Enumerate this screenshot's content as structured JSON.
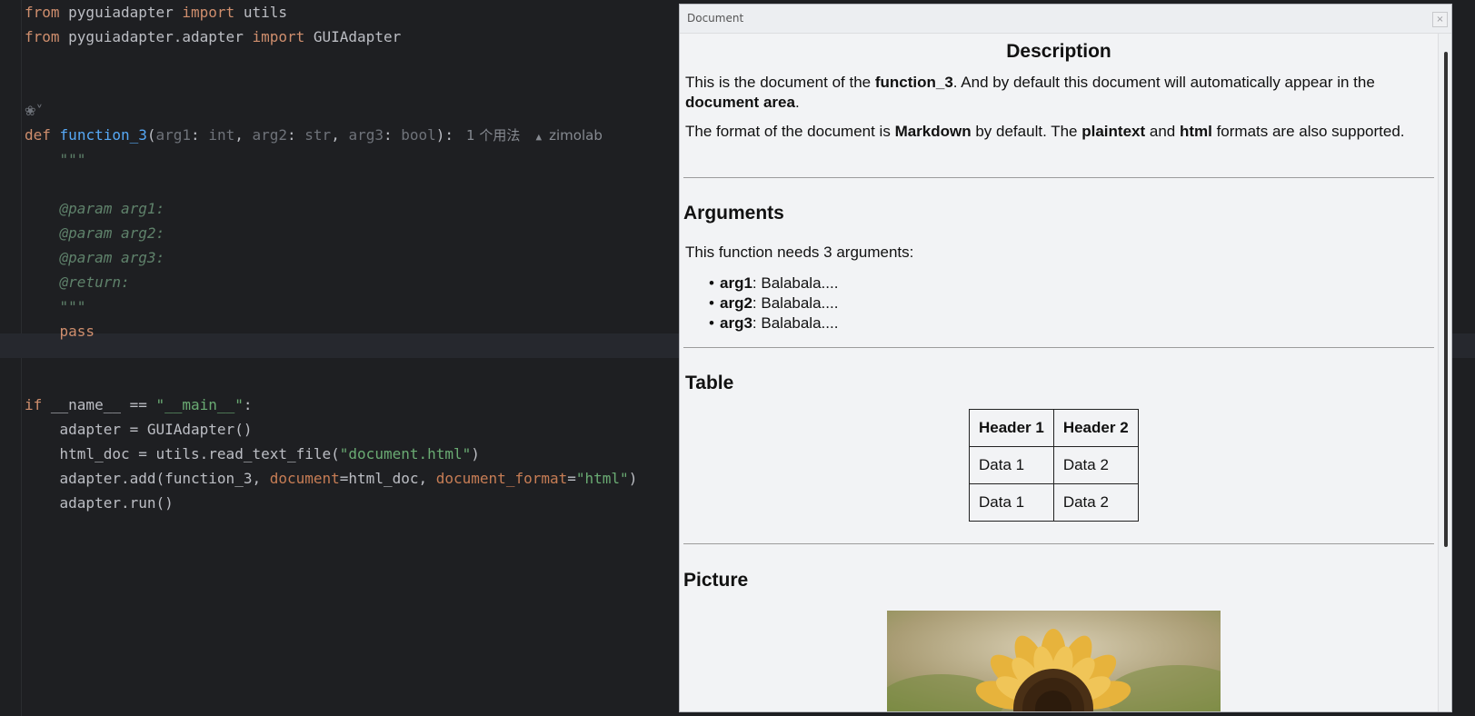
{
  "editor": {
    "lines": [
      {
        "segments": [
          {
            "t": "from",
            "c": "kw"
          },
          {
            "t": " pyguiadapter "
          },
          {
            "t": "import",
            "c": "kw"
          },
          {
            "t": " utils"
          }
        ]
      },
      {
        "segments": [
          {
            "t": "from",
            "c": "kw"
          },
          {
            "t": " pyguiadapter.adapter "
          },
          {
            "t": "import",
            "c": "kw"
          },
          {
            "t": " GUIAdapter"
          }
        ]
      },
      {
        "segments": []
      },
      {
        "segments": []
      },
      {
        "segments": [
          {
            "t": "❀˅",
            "c": "ai-icon"
          }
        ]
      },
      {
        "segments": [
          {
            "t": "def",
            "c": "kw"
          },
          {
            "t": " "
          },
          {
            "t": "function_3",
            "c": "fn"
          },
          {
            "t": "("
          },
          {
            "t": "arg1",
            "c": "param"
          },
          {
            "t": ": "
          },
          {
            "t": "int",
            "c": "param"
          },
          {
            "t": ", "
          },
          {
            "t": "arg2",
            "c": "param"
          },
          {
            "t": ": "
          },
          {
            "t": "str",
            "c": "param"
          },
          {
            "t": ", "
          },
          {
            "t": "arg3",
            "c": "param"
          },
          {
            "t": ": "
          },
          {
            "t": "bool",
            "c": "param"
          },
          {
            "t": "):"
          },
          {
            "t": "",
            "c": "inlay-gap"
          },
          {
            "t": "1 个用法",
            "c": "inlay"
          },
          {
            "t": "",
            "c": "inlay-gap"
          },
          {
            "t": "▲",
            "c": "user-icon"
          },
          {
            "t": " zimolab",
            "c": "inlay"
          }
        ]
      },
      {
        "segments": [
          {
            "t": "    "
          },
          {
            "t": "\"\"\"",
            "c": "doc"
          }
        ]
      },
      {
        "segments": []
      },
      {
        "segments": [
          {
            "t": "    "
          },
          {
            "t": "@param arg1:",
            "c": "doc"
          }
        ]
      },
      {
        "segments": [
          {
            "t": "    "
          },
          {
            "t": "@param arg2:",
            "c": "doc"
          }
        ]
      },
      {
        "segments": [
          {
            "t": "    "
          },
          {
            "t": "@param arg3:",
            "c": "doc"
          }
        ]
      },
      {
        "segments": [
          {
            "t": "    "
          },
          {
            "t": "@return:",
            "c": "doc"
          }
        ]
      },
      {
        "segments": [
          {
            "t": "    "
          },
          {
            "t": "\"\"\"",
            "c": "doc"
          }
        ]
      },
      {
        "segments": [
          {
            "t": "    "
          },
          {
            "t": "pass",
            "c": "kw"
          }
        ]
      },
      {
        "segments": []
      },
      {
        "segments": []
      },
      {
        "segments": [
          {
            "t": "if",
            "c": "kw"
          },
          {
            "t": " __name__ == "
          },
          {
            "t": "\"__main__\"",
            "c": "str"
          },
          {
            "t": ":"
          }
        ]
      },
      {
        "segments": [
          {
            "t": "    adapter = GUIAdapter()"
          }
        ]
      },
      {
        "segments": [
          {
            "t": "    html_doc = utils.read_text_file("
          },
          {
            "t": "\"document.html\"",
            "c": "str"
          },
          {
            "t": ")"
          }
        ]
      },
      {
        "segments": [
          {
            "t": "    adapter.add(function_3, "
          },
          {
            "t": "document",
            "c": "named"
          },
          {
            "t": "=html_doc, "
          },
          {
            "t": "document_format",
            "c": "named"
          },
          {
            "t": "="
          },
          {
            "t": "\"html\"",
            "c": "str"
          },
          {
            "t": ")"
          }
        ]
      },
      {
        "segments": [
          {
            "t": "    adapter.run()"
          }
        ]
      }
    ]
  },
  "document_window": {
    "title": "Document",
    "close_label": "×",
    "description_heading": "Description",
    "p1": {
      "a": "This is the document of the ",
      "b": "function_3",
      "c": ". And by default this document will automatically appear in the ",
      "d": "document area",
      "e": "."
    },
    "p2": {
      "a": "The format of the document is ",
      "b": "Markdown",
      "c": " by default. The ",
      "d": "plaintext",
      "e": " and ",
      "f": "html",
      "g": " formats are also supported."
    },
    "arguments_heading": "Arguments",
    "arguments_intro": "This function needs 3 arguments:",
    "arguments": [
      {
        "name": "arg1",
        "desc": ": Balabala...."
      },
      {
        "name": "arg2",
        "desc": ": Balabala...."
      },
      {
        "name": "arg3",
        "desc": ": Balabala...."
      }
    ],
    "table_heading": "Table",
    "table": {
      "headers": [
        "Header 1",
        "Header 2"
      ],
      "rows": [
        [
          "Data 1",
          "Data 2"
        ],
        [
          "Data 1",
          "Data 2"
        ]
      ]
    },
    "picture_heading": "Picture"
  }
}
